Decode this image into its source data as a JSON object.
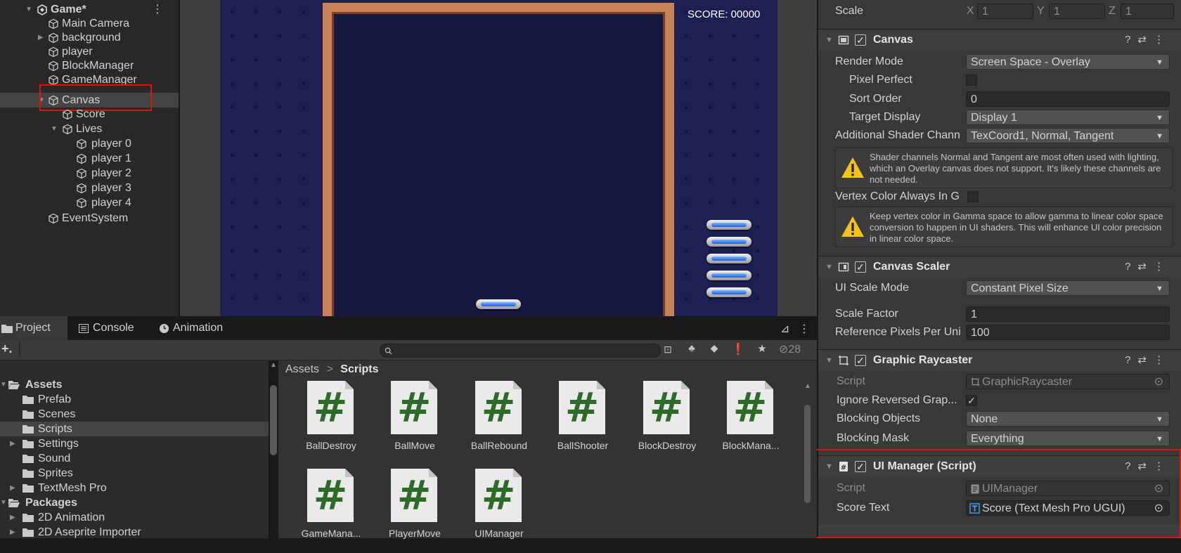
{
  "hierarchy": {
    "items": [
      {
        "label": "Game*",
        "icon": "unity-scene-icon",
        "expanded": true
      },
      {
        "label": "Main Camera",
        "icon": "gameobject-cube-icon"
      },
      {
        "label": "background",
        "icon": "gameobject-cube-icon",
        "collapsed": true
      },
      {
        "label": "player",
        "icon": "gameobject-cube-icon"
      },
      {
        "label": "BlockManager",
        "icon": "gameobject-cube-icon"
      },
      {
        "label": "GameManager",
        "icon": "gameobject-cube-icon"
      },
      {
        "label": "Canvas",
        "icon": "gameobject-cube-icon",
        "expanded": true,
        "selected": true
      },
      {
        "label": "Score",
        "icon": "gameobject-cube-icon"
      },
      {
        "label": "Lives",
        "icon": "gameobject-cube-icon",
        "expanded": true
      },
      {
        "label": "player 0",
        "icon": "gameobject-cube-icon"
      },
      {
        "label": "player 1",
        "icon": "gameobject-cube-icon"
      },
      {
        "label": "player 2",
        "icon": "gameobject-cube-icon"
      },
      {
        "label": "player 3",
        "icon": "gameobject-cube-icon"
      },
      {
        "label": "player 4",
        "icon": "gameobject-cube-icon"
      },
      {
        "label": "EventSystem",
        "icon": "gameobject-cube-icon"
      }
    ],
    "menu_icon": "vertical-dots-icon"
  },
  "scene": {
    "score_text": "SCORE: 00000",
    "lives_count": 5
  },
  "inspector": {
    "scale": {
      "label": "Scale",
      "x_label": "X",
      "x": "1",
      "y_label": "Y",
      "y": "1",
      "z_label": "Z",
      "z": "1"
    },
    "canvas": {
      "title": "Canvas",
      "render_mode_label": "Render Mode",
      "render_mode": "Screen Space - Overlay",
      "pixel_perfect_label": "Pixel Perfect",
      "sort_order_label": "Sort Order",
      "sort_order": "0",
      "target_display_label": "Target Display",
      "target_display": "Display 1",
      "shader_channels_label": "Additional Shader Chann",
      "shader_channels": "TexCoord1, Normal, Tangent",
      "warning1": "Shader channels Normal and Tangent are most often used with lighting, which an Overlay canvas does not support. It's likely these channels are not needed.",
      "vertex_color_label": "Vertex Color Always In G",
      "warning2": "Keep vertex color in Gamma space to allow gamma to linear color space conversion to happen in UI shaders. This will enhance UI color precision in linear color space."
    },
    "canvas_scaler": {
      "title": "Canvas Scaler",
      "ui_scale_mode_label": "UI Scale Mode",
      "ui_scale_mode": "Constant Pixel Size",
      "scale_factor_label": "Scale Factor",
      "scale_factor": "1",
      "ref_ppu_label": "Reference Pixels Per Uni",
      "ref_ppu": "100"
    },
    "graphic_raycaster": {
      "title": "Graphic Raycaster",
      "script_label": "Script",
      "script": "GraphicRaycaster",
      "ignore_reversed_label": "Ignore Reversed Grap...",
      "blocking_objects_label": "Blocking Objects",
      "blocking_objects": "None",
      "blocking_mask_label": "Blocking Mask",
      "blocking_mask": "Everything"
    },
    "ui_manager": {
      "title": "UI Manager (Script)",
      "script_label": "Script",
      "script": "UIManager",
      "score_text_label": "Score Text",
      "score_text": "Score (Text Mesh Pro UGUI)"
    }
  },
  "project": {
    "tabs": [
      {
        "label": "Project",
        "icon": "folder-icon"
      },
      {
        "label": "Console",
        "icon": "console-icon"
      },
      {
        "label": "Animation",
        "icon": "clock-icon"
      }
    ],
    "add_label": "+.",
    "hidden_count": "28",
    "tree": [
      {
        "label": "Assets",
        "level": 0,
        "expanded": true,
        "open": true
      },
      {
        "label": "Prefab",
        "level": 1
      },
      {
        "label": "Scenes",
        "level": 1
      },
      {
        "label": "Scripts",
        "level": 1,
        "selected": true
      },
      {
        "label": "Settings",
        "level": 1,
        "collapsed": true
      },
      {
        "label": "Sound",
        "level": 1
      },
      {
        "label": "Sprites",
        "level": 1
      },
      {
        "label": "TextMesh Pro",
        "level": 1,
        "collapsed": true
      },
      {
        "label": "Packages",
        "level": 0,
        "expanded": true,
        "open": true
      },
      {
        "label": "2D Animation",
        "level": 1,
        "collapsed": true
      },
      {
        "label": "2D Aseprite Importer",
        "level": 1,
        "collapsed": true
      }
    ],
    "breadcrumb": {
      "root": "Assets",
      "sep": ">",
      "current": "Scripts"
    },
    "assets": [
      "BallDestroy",
      "BallMove",
      "BallRebound",
      "BallShooter",
      "BlockDestroy",
      "BlockMana...",
      "GameMana...",
      "PlayerMove",
      "UIManager"
    ]
  }
}
